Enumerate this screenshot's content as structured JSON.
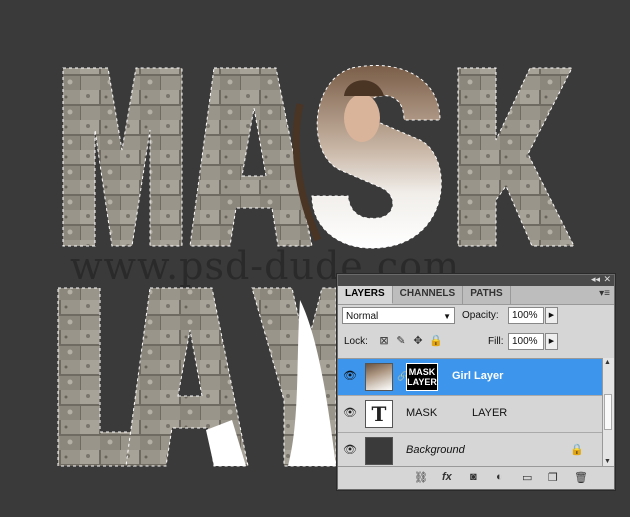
{
  "canvas": {
    "letters_row1": "MASK",
    "letters_row2": "LAY",
    "watermark": "www.psd-dude.com"
  },
  "panel": {
    "tabs": [
      {
        "label": "LAYERS",
        "active": true
      },
      {
        "label": "CHANNELS",
        "active": false
      },
      {
        "label": "PATHS",
        "active": false
      }
    ],
    "blend_mode": "Normal",
    "opacity_label": "Opacity:",
    "opacity_value": "100%",
    "lock_label": "Lock:",
    "fill_label": "Fill:",
    "fill_value": "100%",
    "layers": [
      {
        "name": "Girl Layer",
        "selected": true,
        "mask_text": "MASK LAYER",
        "thumb_icon": "photo-thumbnail"
      },
      {
        "name": "MASK",
        "name2": "LAYER",
        "selected": false,
        "thumb_icon": "text-layer-T"
      },
      {
        "name": "Background",
        "selected": false,
        "locked": true,
        "thumb_icon": "solid-fill"
      }
    ],
    "bottom_icons": [
      "link-icon",
      "fx-icon",
      "mask-icon",
      "adjustment-icon",
      "group-icon",
      "new-layer-icon",
      "trash-icon"
    ]
  },
  "colors": {
    "canvas_bg": "#3a3a3a",
    "panel_bg": "#d6d6d6",
    "selection": "#3d95ec"
  }
}
